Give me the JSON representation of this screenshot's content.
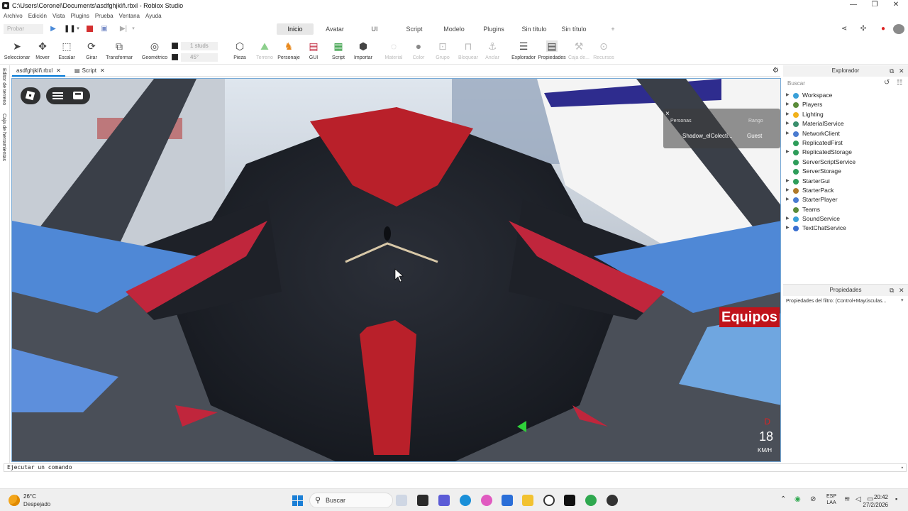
{
  "window": {
    "title": "C:\\Users\\Coronel\\Documents\\asdfghjklñ.rbxl - Roblox Studio",
    "controls": [
      "—",
      "❐",
      "✕"
    ]
  },
  "menu": [
    "Archivo",
    "Edición",
    "Vista",
    "Plugins",
    "Prueba",
    "Ventana",
    "Ayuda"
  ],
  "run": {
    "test_label": "Probar"
  },
  "ribbon_tabs": [
    "Inicio",
    "Avatar",
    "UI",
    "Script",
    "Modelo",
    "Plugins",
    "Sin título",
    "Sin título"
  ],
  "ribbon_tab_add": "+",
  "tools": {
    "select": "Seleccionar",
    "move": "Mover",
    "scale": "Escalar",
    "rotate": "Girar",
    "transform": "Transformar",
    "geometric": "Geométrico",
    "snap_move": "1 studs",
    "snap_rotate": "45°",
    "part": "Pieza",
    "terrain": "Terreno",
    "character": "Personaje",
    "gui": "GUI",
    "script": "Script",
    "import": "Importar",
    "material": "Material",
    "color": "Color",
    "group": "Grupo",
    "lock": "Bloquear",
    "anchor": "Anclar",
    "explorer": "Explorador",
    "properties": "Propiedades",
    "toolbox": "Caja de...",
    "assets": "Recursos"
  },
  "doc_tabs": [
    {
      "label": "asdfghjklñ.rbxl",
      "close": "✕"
    },
    {
      "label": "Script",
      "close": "✕"
    }
  ],
  "left_strip": [
    "Editor de terreno",
    "Caja de herramientas"
  ],
  "game_ui": {
    "player_list": {
      "header_people": "Personas",
      "header_rank": "Rango",
      "player_name": "Shadow_elColecti...",
      "player_rank": "Guest"
    },
    "teams_label": "Equipos",
    "gear": "D",
    "speed": "18",
    "speed_unit": "KM/H"
  },
  "explorer": {
    "title": "Explorador",
    "search_placeholder": "Buscar",
    "items": [
      {
        "label": "Workspace",
        "color": "#3aa0d8",
        "expandable": true
      },
      {
        "label": "Players",
        "color": "#5a8c3a",
        "expandable": true
      },
      {
        "label": "Lighting",
        "color": "#f2b21b",
        "expandable": true
      },
      {
        "label": "MaterialService",
        "color": "#3a8f6d",
        "expandable": true
      },
      {
        "label": "NetworkClient",
        "color": "#4a7bd0",
        "expandable": true
      },
      {
        "label": "ReplicatedFirst",
        "color": "#2e9d5a",
        "expandable": false
      },
      {
        "label": "ReplicatedStorage",
        "color": "#2e9d5a",
        "expandable": true
      },
      {
        "label": "ServerScriptService",
        "color": "#2e9d5a",
        "expandable": false
      },
      {
        "label": "ServerStorage",
        "color": "#2e9d5a",
        "expandable": false
      },
      {
        "label": "StarterGui",
        "color": "#2e9d5a",
        "expandable": true
      },
      {
        "label": "StarterPack",
        "color": "#b07a2a",
        "expandable": true
      },
      {
        "label": "StarterPlayer",
        "color": "#4a7bd0",
        "expandable": true
      },
      {
        "label": "Teams",
        "color": "#5a8c3a",
        "expandable": false
      },
      {
        "label": "SoundService",
        "color": "#3aa0d8",
        "expandable": true
      },
      {
        "label": "TextChatService",
        "color": "#3a6fd0",
        "expandable": true
      }
    ]
  },
  "properties": {
    "title": "Propiedades",
    "filter_placeholder": "Propiedades del filtro: (Control+Mayúsculas..."
  },
  "command_bar": {
    "placeholder": "Ejecutar un comando"
  },
  "taskbar": {
    "temperature": "26°C",
    "weather": "Despejado",
    "search": "Buscar",
    "lang_line1": "ESP",
    "lang_line2": "LAA",
    "time": "20:42",
    "date": "27/2/2026"
  }
}
